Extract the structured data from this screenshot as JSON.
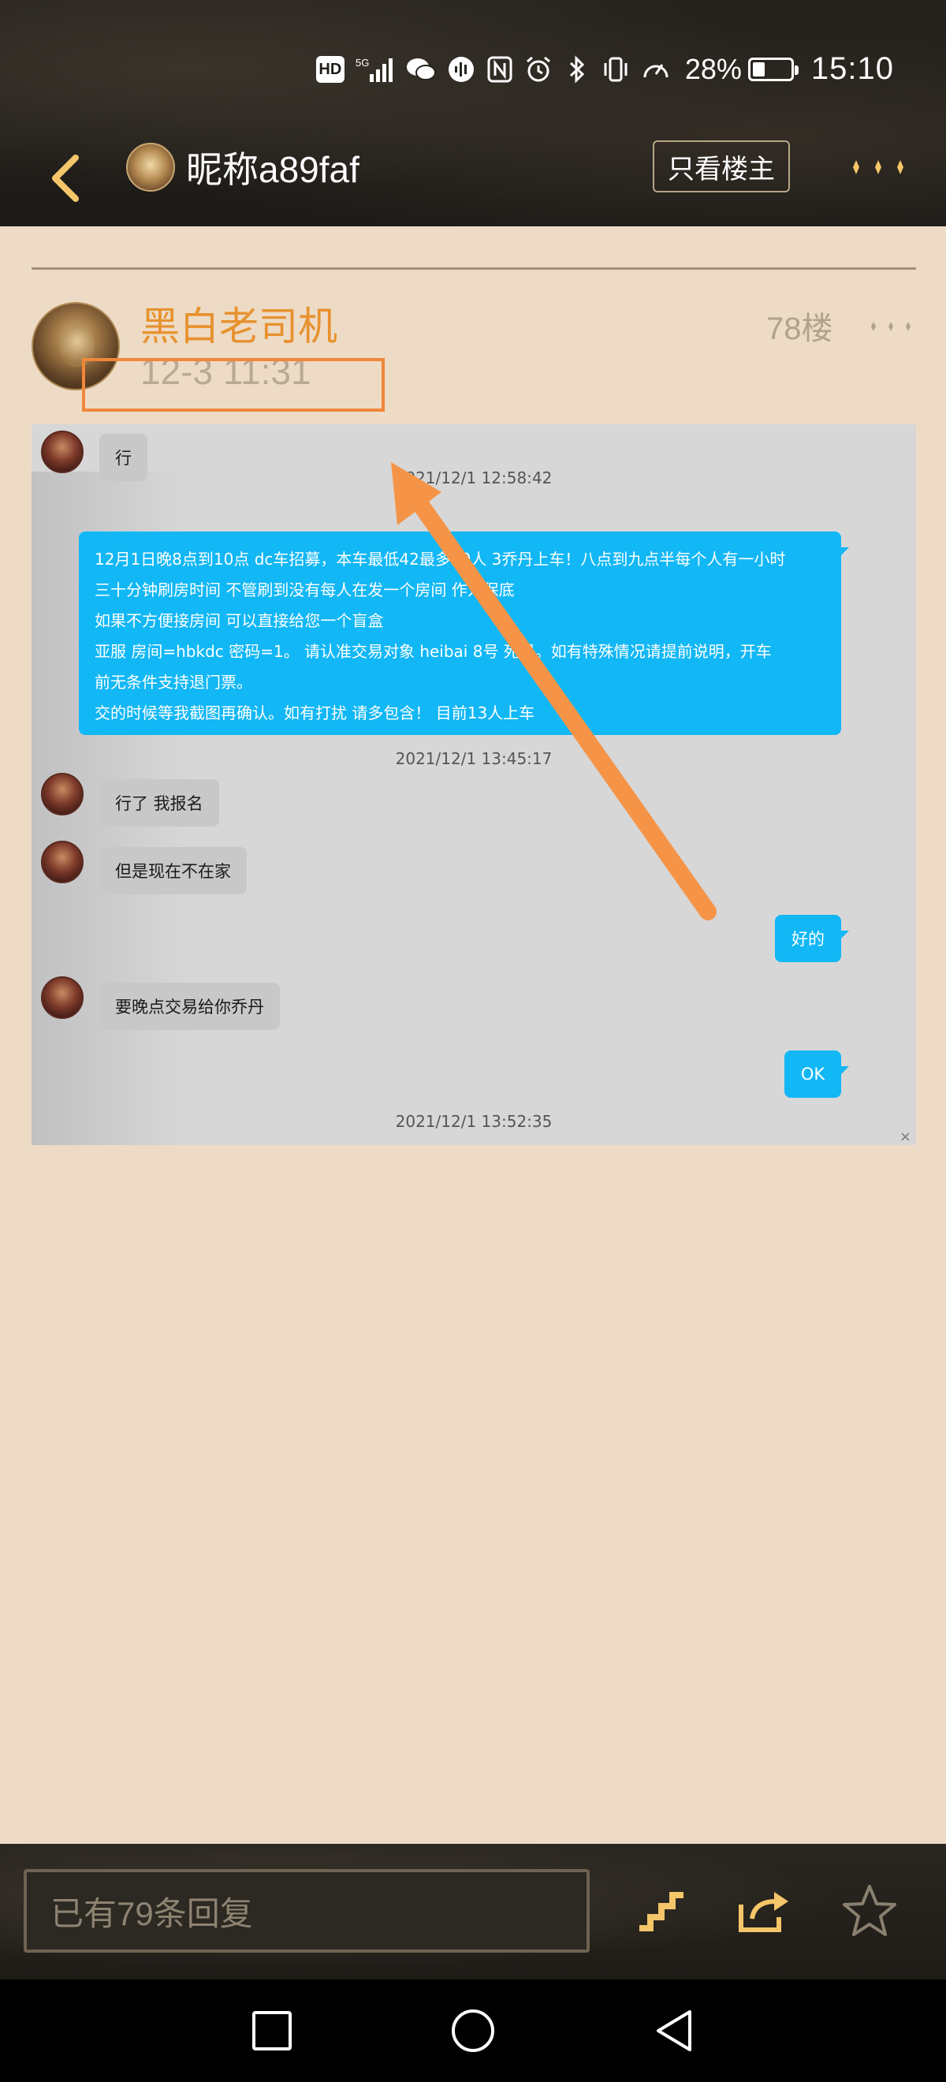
{
  "status_bar": {
    "hd_label": "HD",
    "network_label": "5G",
    "battery_percent": "28%",
    "battery_level": 0.28,
    "time": "15:10",
    "icons": [
      "hd-icon",
      "signal-5g-icon",
      "wechat-icon",
      "voice-icon",
      "nfc-icon",
      "alarm-icon",
      "bluetooth-icon",
      "vibrate-icon",
      "speed-icon",
      "battery-icon"
    ]
  },
  "toolbar": {
    "title": "昵称a89faf",
    "only_op_label": "只看楼主",
    "back_icon": "chevron-left-icon",
    "more_icon": "more-dots-icon",
    "accent_color": "#f5c56a"
  },
  "post": {
    "author": "黑白老司机",
    "time": "12-3 11:31",
    "floor": "78楼",
    "author_color": "#e7922f",
    "highlight_color": "#f0873a"
  },
  "chat": {
    "messages": [
      {
        "side": "left",
        "text": "行"
      },
      {
        "side": "stamp",
        "text": "2021/12/1 12:58:42"
      },
      {
        "side": "right-big",
        "lines": [
          "12月1日晚8点到10点 dc车招募，本车最低42最多50人 3乔丹上车！八点到九点半每个人有一小时",
          "三十分钟刷房时间  不管刷到没有每人在发一个房间 作为保底",
          "如果不方便接房间 可以直接给您一个盲盒",
          " 亚服 房间=hbkdc 密码=1。 请认准交易对象 heibai 8号 死灵。如有特殊情况请提前说明，开车",
          "前无条件支持退门票。",
          "交的时候等我截图再确认。如有打扰 请多包含！     目前13人上车"
        ]
      },
      {
        "side": "stamp",
        "text": "2021/12/1 13:45:17"
      },
      {
        "side": "left",
        "text": "行了  我报名"
      },
      {
        "side": "left",
        "text": "但是现在不在家"
      },
      {
        "side": "right",
        "text": "好的"
      },
      {
        "side": "left",
        "text": "要晚点交易给你乔丹"
      },
      {
        "side": "right",
        "text": "OK"
      },
      {
        "side": "stamp",
        "text": "2021/12/1 13:52:35"
      }
    ],
    "bubble_color": "#12b7f5",
    "close_glyph": "×"
  },
  "bottom_bar": {
    "reply_placeholder": "已有79条回复",
    "icons": [
      "stairs-icon",
      "share-icon",
      "star-icon"
    ]
  },
  "nav_bar": {
    "icons": [
      "square-recents-icon",
      "circle-home-icon",
      "triangle-back-icon"
    ]
  }
}
